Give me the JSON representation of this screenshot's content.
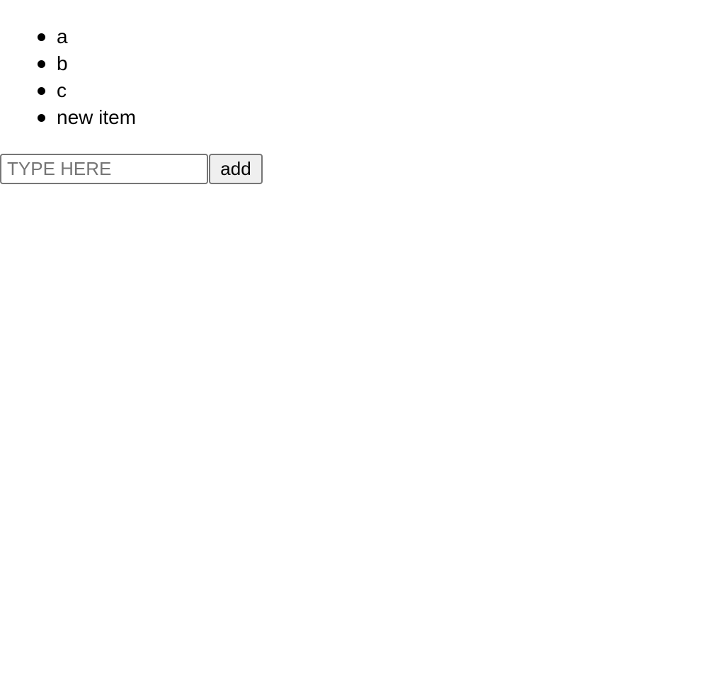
{
  "list": {
    "items": [
      {
        "label": "a"
      },
      {
        "label": "b"
      },
      {
        "label": "c"
      },
      {
        "label": "new item"
      }
    ]
  },
  "form": {
    "input_placeholder": "TYPE HERE",
    "input_value": "",
    "add_label": "add"
  },
  "colors": {
    "background": "#ffffff",
    "text": "#000000",
    "placeholder": "#757575",
    "button_background": "#efefef",
    "border": "#767676"
  }
}
